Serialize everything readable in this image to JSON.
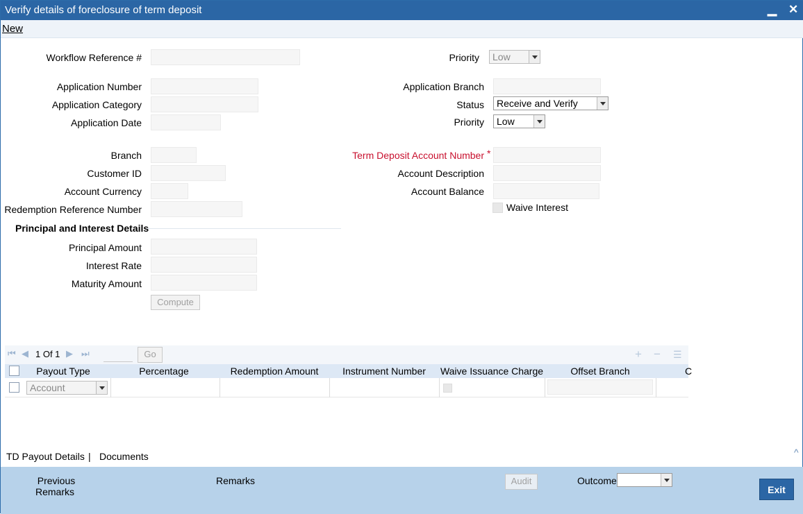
{
  "window": {
    "title": "Verify details of foreclosure of term deposit",
    "minimize_glyph": "▁",
    "close_glyph": "✕"
  },
  "menu": {
    "new_label": "New"
  },
  "header": {
    "workflow_ref_label": "Workflow Reference #",
    "priority_label": "Priority",
    "priority_value": "Low"
  },
  "application": {
    "number_label": "Application Number",
    "category_label": "Application Category",
    "date_label": "Application Date",
    "branch_label": "Application Branch",
    "status_label": "Status",
    "status_value": "Receive and Verify",
    "priority_label": "Priority",
    "priority_value": "Low"
  },
  "account": {
    "branch_label": "Branch",
    "customer_id_label": "Customer ID",
    "currency_label": "Account Currency",
    "redemption_ref_label": "Redemption Reference Number",
    "td_account_label": "Term Deposit Account Number",
    "required_mark": "*",
    "description_label": "Account Description",
    "balance_label": "Account Balance",
    "waive_interest_label": "Waive Interest"
  },
  "principal": {
    "section_title": "Principal and Interest Details",
    "amount_label": "Principal Amount",
    "rate_label": "Interest Rate",
    "maturity_label": "Maturity Amount",
    "compute_label": "Compute"
  },
  "grid": {
    "page_text": "1 Of 1",
    "go_label": "Go",
    "columns": [
      "Payout Type",
      "Percentage",
      "Redemption Amount",
      "Instrument Number",
      "Waive Issuance Charge",
      "Offset Branch",
      "C"
    ],
    "row_payout_type": "Account"
  },
  "tabs": {
    "payout_details": "TD Payout Details",
    "separator": "|",
    "documents": "Documents",
    "collapse_glyph": "^"
  },
  "footer": {
    "previous_remarks_1": "Previous",
    "previous_remarks_2": "Remarks",
    "remarks_label": "Remarks",
    "audit_label": "Audit",
    "outcome_label": "Outcome",
    "exit_label": "Exit"
  }
}
